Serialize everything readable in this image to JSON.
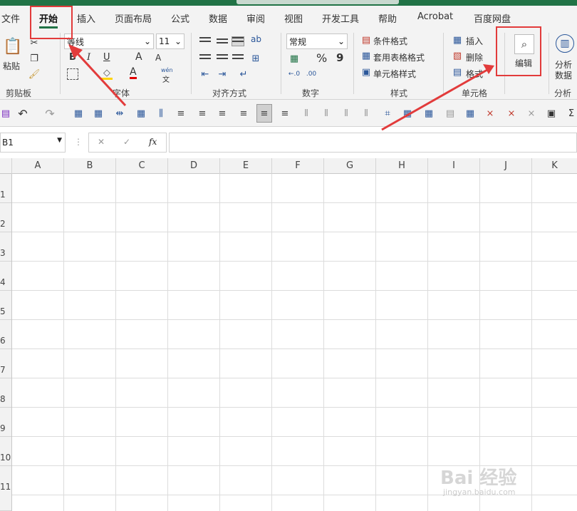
{
  "tabs": [
    "文件",
    "开始",
    "插入",
    "页面布局",
    "公式",
    "数据",
    "审阅",
    "视图",
    "开发工具",
    "帮助",
    "Acrobat",
    "百度网盘"
  ],
  "ribbon": {
    "paste_label": "粘贴",
    "font_name": "等线",
    "font_size": "11",
    "number_format": "常规",
    "conditional_format": "条件格式",
    "table_format": "套用表格格式",
    "cell_style": "单元格样式",
    "insert": "插入",
    "delete": "删除",
    "format": "格式",
    "edit": "编辑",
    "analyze": "分析\n数据",
    "analyze_line1": "分析",
    "analyze_line2": "数据",
    "groups": {
      "clipboard": "剪贴板",
      "font": "字体",
      "alignment": "对齐方式",
      "number": "数字",
      "styles": "样式",
      "cells": "单元格",
      "analysis": "分析"
    },
    "bold": "B",
    "italic": "I",
    "underline": "U",
    "grow_font": "A",
    "shrink_font": "A",
    "font_color_letter": "A",
    "wen": "wén",
    "wen2": "文",
    "percent": "%",
    "comma": "9",
    "ab_text": "ab"
  },
  "formula_bar": {
    "name_box": "B1",
    "fx": "fx",
    "cancel": "✕",
    "enter": "✓",
    "value": ""
  },
  "columns": [
    "A",
    "B",
    "C",
    "D",
    "E",
    "F",
    "G",
    "H",
    "I",
    "J",
    "K"
  ],
  "rows": [
    "1",
    "2",
    "3",
    "4",
    "5",
    "6",
    "7",
    "8",
    "9",
    "10",
    "11"
  ],
  "watermark": {
    "main": "Bai 经验",
    "sub": "jingyan.baidu.com"
  },
  "colors": {
    "accent": "#217346",
    "annotation": "#e23b3b",
    "quick_access_icons": "#2b579a"
  },
  "icons": [
    "undo-icon",
    "redo-icon",
    "search-icon",
    "paste-icon",
    "cut-icon",
    "copy-icon",
    "format-painter-icon",
    "border-icon",
    "fill-color-icon"
  ]
}
